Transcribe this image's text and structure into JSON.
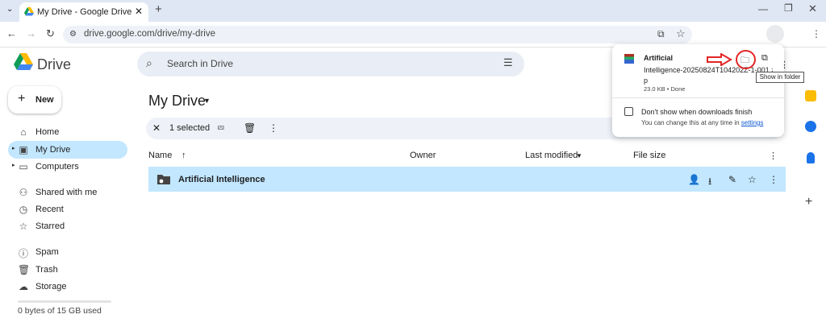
{
  "browser": {
    "tab_title": "My Drive - Google Drive",
    "url": "drive.google.com/drive/my-drive"
  },
  "app": {
    "name": "Drive",
    "search_placeholder": "Search in Drive",
    "new_label": "New"
  },
  "sidebar": {
    "items": [
      {
        "label": "Home",
        "icon": "home-icon"
      },
      {
        "label": "My Drive",
        "icon": "drive-icon",
        "active": true
      },
      {
        "label": "Computers",
        "icon": "computers-icon"
      },
      {
        "label": "Shared with me",
        "icon": "people-icon"
      },
      {
        "label": "Recent",
        "icon": "clock-icon"
      },
      {
        "label": "Starred",
        "icon": "star-icon"
      },
      {
        "label": "Spam",
        "icon": "spam-icon"
      },
      {
        "label": "Trash",
        "icon": "trash-icon"
      },
      {
        "label": "Storage",
        "icon": "cloud-icon"
      }
    ],
    "storage_text": "0 bytes of 15 GB used"
  },
  "main": {
    "title": "My Drive",
    "selection_text": "1 selected",
    "columns": [
      "Name",
      "Owner",
      "Last modified",
      "File size"
    ],
    "rows": [
      {
        "name": "Artificial Intelligence"
      }
    ]
  },
  "downloads": {
    "file_line1": "Artificial",
    "file_line2": "Intelligence-20250824T104202Z-1-001.zi",
    "file_line3": "p",
    "file_meta": "23.0 KB • Done",
    "tooltip": "Show in folder",
    "checkbox_label": "Don't show when downloads finish",
    "hint_text": "You can change this at any time in",
    "hint_link": "settings"
  },
  "colors": {
    "accent": "#0b57d0",
    "selected_row": "#c2e7ff",
    "annotation": "#e32626"
  }
}
